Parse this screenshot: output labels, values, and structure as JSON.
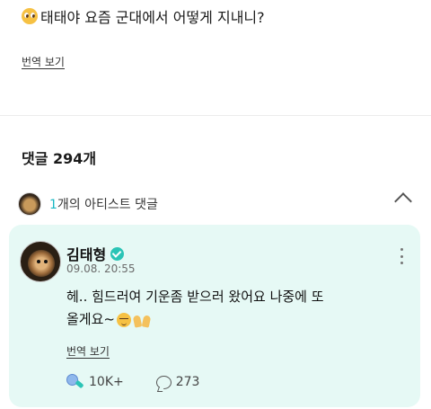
{
  "post": {
    "emoji": "pleading-face-emoji",
    "text": "태태야 요즘 군대에서 어떻게 지내니?",
    "translate_label": "번역 보기"
  },
  "comments": {
    "count_label": "댓글 294개"
  },
  "artist_section": {
    "count": "1",
    "label": "개의 아티스트 댓글",
    "expanded": true
  },
  "artist_comment": {
    "author": "김태형",
    "verified": true,
    "timestamp": "09.08. 20:55",
    "line1": "헤.. 힘드러여 기운좀 받으러 왔어요 나중에 또",
    "line2": "올게요~",
    "emojis": [
      "relieved-face-emoji",
      "raising-hands-emoji"
    ],
    "translate_label": "번역 보기",
    "like_count": "10K+",
    "reply_count": "273"
  },
  "colors": {
    "accent": "#18b8c4",
    "card_background": "#e6f9f5",
    "verified": "#2bc4b6"
  }
}
